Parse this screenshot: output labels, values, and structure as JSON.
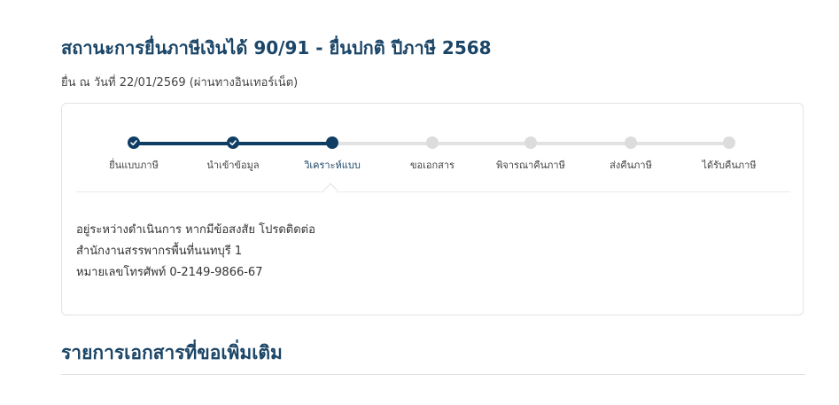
{
  "header": {
    "title": "สถานะการยื่นภาษีเงินได้ 90/91 - ยื่นปกติ ปีภาษี 2568",
    "filed_info": "ยื่น ณ วันที่ 22/01/2569 (ผ่านทางอินเทอร์เน็ต)"
  },
  "stepper": {
    "steps": [
      {
        "label": "ยื่นแบบภาษี",
        "state": "done"
      },
      {
        "label": "นำเข้าข้อมูล",
        "state": "done"
      },
      {
        "label": "วิเคราะห์แบบ",
        "state": "current"
      },
      {
        "label": "ขอเอกสาร",
        "state": "todo"
      },
      {
        "label": "พิจารณาคืนภาษี",
        "state": "todo"
      },
      {
        "label": "ส่งคืนภาษี",
        "state": "todo"
      },
      {
        "label": "ได้รับคืนภาษี",
        "state": "todo"
      }
    ],
    "icons": {
      "done": "check-icon"
    },
    "colors": {
      "done": "#0f3d63",
      "todo": "#dcdcdc"
    }
  },
  "status_message": {
    "line1": "อยู่ระหว่างดำเนินการ หากมีข้อสงสัย โปรดติดต่อ",
    "line2": "สำนักงานสรรพากรพื้นที่นนทบุรี 1",
    "line3": "หมายเลขโทรศัพท์ 0-2149-9866-67"
  },
  "documents_section": {
    "title": "รายการเอกสารที่ขอเพิ่มเติม"
  }
}
